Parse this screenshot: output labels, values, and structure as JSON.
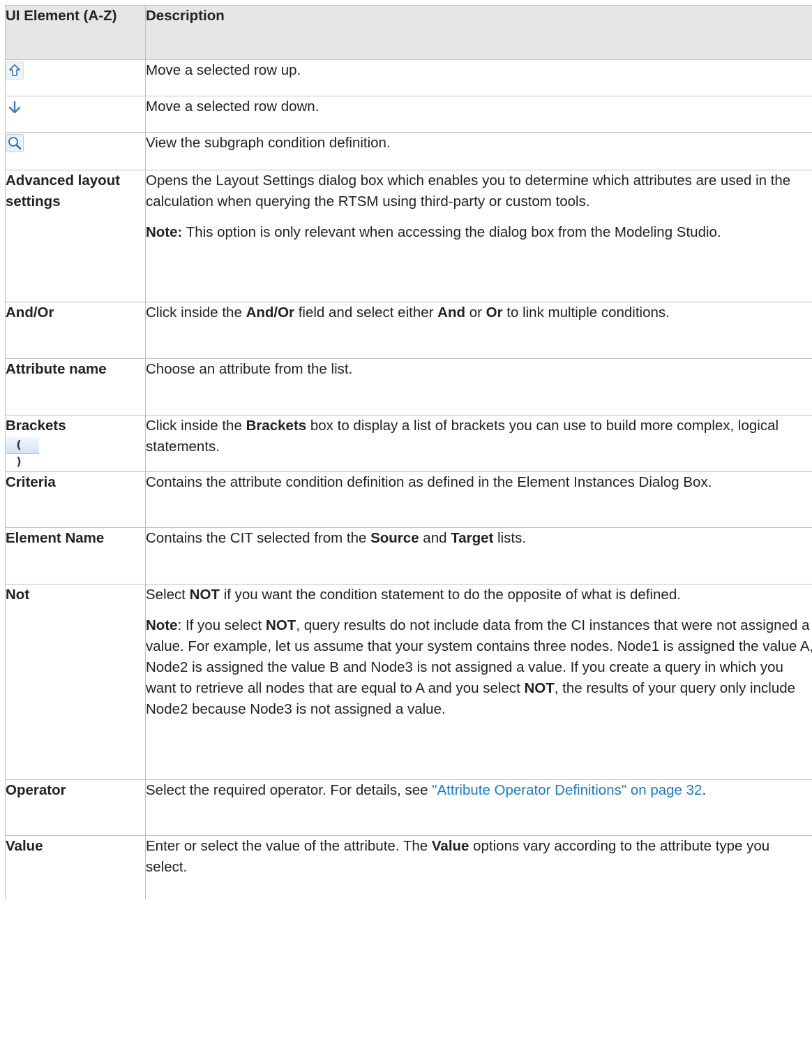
{
  "header": {
    "col1": "UI Element (A-Z)",
    "col2": "Description"
  },
  "rows": {
    "up": {
      "icon": "move-up-arrow-icon",
      "desc": "Move a selected row up."
    },
    "down": {
      "icon": "move-down-arrow-icon",
      "desc": "Move a selected row down."
    },
    "view": {
      "icon": "magnifier-view-icon",
      "desc": "View the subgraph condition definition."
    },
    "advanced": {
      "name": "Advanced layout settings",
      "desc": "Opens the Layout Settings dialog box which enables you to determine which attributes are used in the calculation when querying the RTSM using third-party or custom tools.",
      "note_label": "Note:",
      "note": " This option is only relevant when accessing the dialog box from the Modeling Studio."
    },
    "andor": {
      "name": "And/Or",
      "t1": "Click inside the ",
      "b1": "And/Or",
      "t2": " field and select either ",
      "b2": "And",
      "t3": " or ",
      "b3": "Or",
      "t4": " to link multiple conditions."
    },
    "attr": {
      "name": "Attribute name",
      "desc": "Choose an attribute from the list."
    },
    "brackets": {
      "name": "Brackets",
      "glyph": "( )",
      "t1": "Click inside the ",
      "b1": "Brackets",
      "t2": " box to display a list of brackets you can use to build more complex, logical statements."
    },
    "criteria": {
      "name": "Criteria",
      "desc": "Contains the attribute condition definition as defined in the Element Instances Dialog Box."
    },
    "element": {
      "name": "Element Name",
      "t1": "Contains the CIT selected from the ",
      "b1": "Source",
      "t2": " and ",
      "b2": "Target",
      "t3": " lists."
    },
    "not": {
      "name": "Not",
      "t1": "Select ",
      "b1": "NOT",
      "t2": " if you want the condition statement to do the opposite of what is defined.",
      "note_label": "Note",
      "n1": ": If you select ",
      "nb1": "NOT",
      "n2": ", query results do not include data from the CI instances that were not assigned a value. For example, let us assume that your system contains three nodes. Node1 is assigned the value A, Node2 is assigned the value B and Node3 is not assigned a value. If you create a query in which you want to retrieve all nodes that are equal to A and you select ",
      "nb2": "NOT",
      "n3": ", the results of your query only include Node2 because Node3 is not assigned a value."
    },
    "operator": {
      "name": "Operator",
      "t1": "Select the required operator. For details, see ",
      "link": "\"Attribute Operator Definitions\" on page 32",
      "t2": "."
    },
    "value": {
      "name": "Value",
      "t1": "Enter or select the value of the attribute. The ",
      "b1": "Value",
      "t2": " options vary according to the attribute type you select."
    }
  },
  "colors": {
    "header_bg": "#e6e6e6",
    "border": "#bfbfbf",
    "link": "#1a7ac2"
  }
}
